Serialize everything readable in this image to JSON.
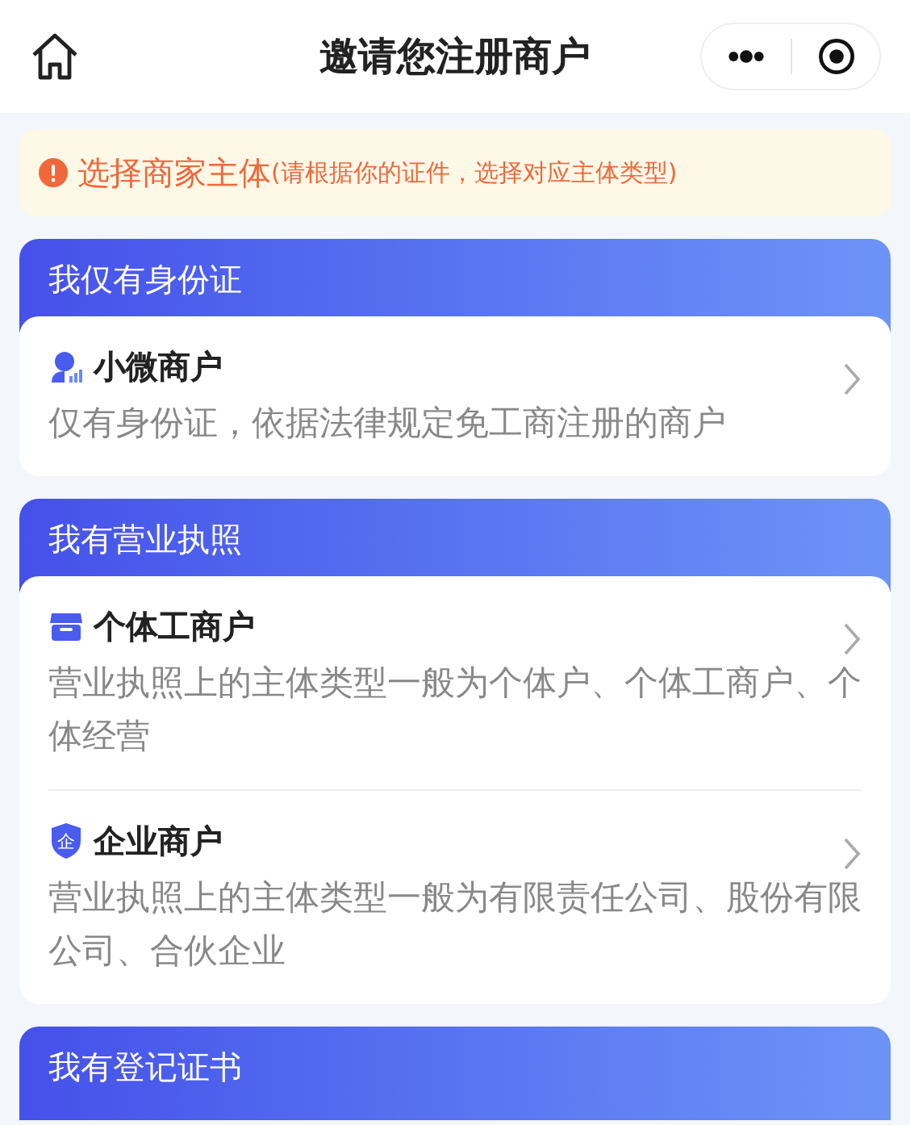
{
  "header": {
    "title": "邀请您注册商户"
  },
  "notice": {
    "title": "选择商家主体",
    "hint": "(请根据你的证件，选择对应主体类型)"
  },
  "sections": [
    {
      "title": "我仅有身份证",
      "items": [
        {
          "kind": "person",
          "name": "小微商户",
          "description": "仅有身份证，依据法律规定免工商注册的商户"
        }
      ]
    },
    {
      "title": "我有营业执照",
      "items": [
        {
          "kind": "store",
          "name": "个体工商户",
          "description": "营业执照上的主体类型一般为个体户、个体工商户、个体经营"
        },
        {
          "kind": "shield",
          "badge": "企",
          "name": "企业商户",
          "description": "营业执照上的主体类型一般为有限责任公司、股份有限公司、合伙企业"
        }
      ]
    },
    {
      "title": "我有登记证书"
    }
  ]
}
